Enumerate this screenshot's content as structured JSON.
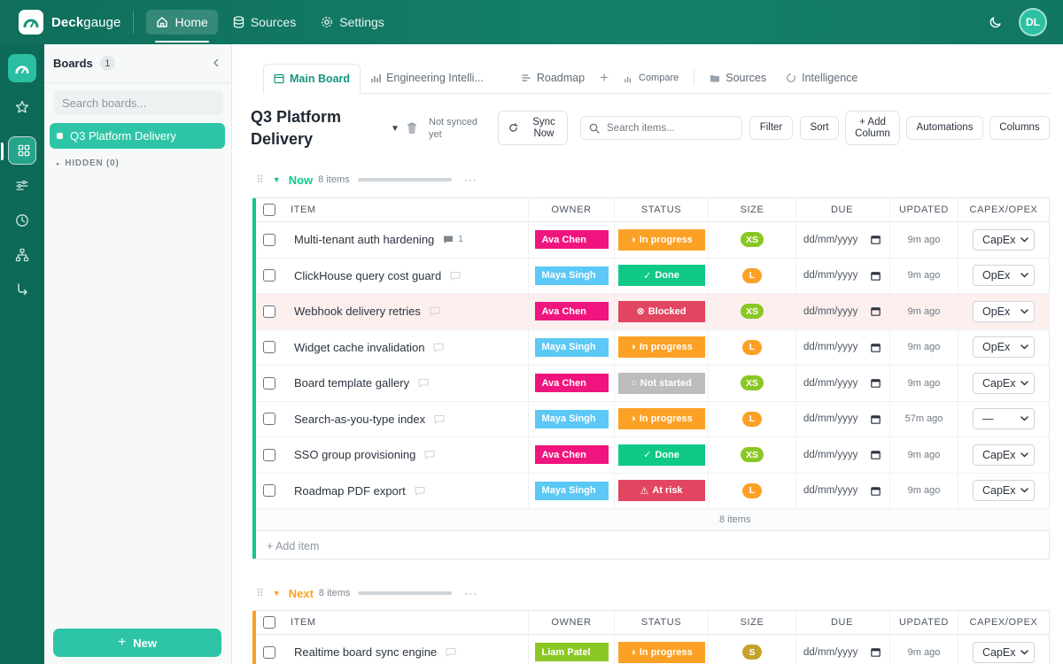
{
  "app": {
    "brand_bold": "Deck",
    "brand_light": "gauge",
    "nav": [
      {
        "label": "Home",
        "icon": "home-icon",
        "active": true
      },
      {
        "label": "Sources",
        "icon": "database-icon"
      },
      {
        "label": "Settings",
        "icon": "gear-icon"
      }
    ],
    "user_initials": "DL"
  },
  "sidebar": {
    "title": "Boards",
    "count": "1",
    "search_placeholder": "Search boards...",
    "boards": [
      {
        "label": "Q3 Platform Delivery"
      }
    ],
    "hidden_label": "HIDDEN (0)",
    "new_label": "New"
  },
  "tabs": [
    {
      "label": "Main Board",
      "icon": "table-icon",
      "active": true
    },
    {
      "label": "Engineering Intelli...",
      "icon": "bar-chart-icon"
    },
    {
      "label": "Roadmap",
      "icon": "list-icon"
    },
    {
      "label": "+",
      "icon": "plus-icon"
    },
    {
      "label": "Compare",
      "icon": "bar-chart-icon"
    },
    {
      "label": "Sources",
      "icon": "folder-icon"
    },
    {
      "label": "Intelligence",
      "icon": "circle-icon"
    }
  ],
  "toolbar": {
    "board_title": "Q3 Platform Delivery",
    "sync_status": "Not synced yet",
    "sync_now": "Sync Now",
    "search_placeholder": "Search items...",
    "filter": "Filter",
    "sort": "Sort",
    "add_column": "+ Add Column",
    "automations": "Automations",
    "columns": "Columns"
  },
  "columns": [
    "ITEM",
    "OWNER",
    "STATUS",
    "SIZE",
    "DUE",
    "UPDATED",
    "CAPEX/OPEX"
  ],
  "colors": {
    "ava": "#f0157e",
    "maya": "#5bc8f5",
    "liam": "#8bc724",
    "in_progress": "#fba126",
    "done": "#10c987",
    "blocked": "#e24560",
    "not_started": "#bdbdbd",
    "at_risk": "#e24560",
    "size_xs": "#8bc724",
    "size_l": "#fba126",
    "size_s": "#c4a22b",
    "now": "#10c987",
    "next": "#fba126"
  },
  "groups": [
    {
      "name": "Now",
      "count": "8 items",
      "summary": "8 items",
      "add_item": "+ Add item",
      "rows": [
        {
          "item": "Multi-tenant auth hardening",
          "comments": "1",
          "owner": "Ava Chen",
          "status": "In progress",
          "size": "XS",
          "due": "dd/mm/yyyy",
          "updated": "9m ago",
          "capex": "CapEx"
        },
        {
          "item": "ClickHouse query cost guard",
          "comments": "",
          "owner": "Maya Singh",
          "status": "Done",
          "size": "L",
          "due": "dd/mm/yyyy",
          "updated": "9m ago",
          "capex": "OpEx"
        },
        {
          "item": "Webhook delivery retries",
          "comments": "",
          "owner": "Ava Chen",
          "status": "Blocked",
          "size": "XS",
          "due": "dd/mm/yyyy",
          "updated": "9m ago",
          "capex": "OpEx"
        },
        {
          "item": "Widget cache invalidation",
          "comments": "",
          "owner": "Maya Singh",
          "status": "In progress",
          "size": "L",
          "due": "dd/mm/yyyy",
          "updated": "9m ago",
          "capex": "OpEx"
        },
        {
          "item": "Board template gallery",
          "comments": "",
          "owner": "Ava Chen",
          "status": "Not started",
          "size": "XS",
          "due": "dd/mm/yyyy",
          "updated": "9m ago",
          "capex": "CapEx"
        },
        {
          "item": "Search-as-you-type index",
          "comments": "",
          "owner": "Maya Singh",
          "status": "In progress",
          "size": "L",
          "due": "dd/mm/yyyy",
          "updated": "57m ago",
          "capex": "—"
        },
        {
          "item": "SSO group provisioning",
          "comments": "",
          "owner": "Ava Chen",
          "status": "Done",
          "size": "XS",
          "due": "dd/mm/yyyy",
          "updated": "9m ago",
          "capex": "CapEx"
        },
        {
          "item": "Roadmap PDF export",
          "comments": "",
          "owner": "Maya Singh",
          "status": "At risk",
          "size": "L",
          "due": "dd/mm/yyyy",
          "updated": "9m ago",
          "capex": "CapEx"
        }
      ]
    },
    {
      "name": "Next",
      "count": "8 items",
      "rows": [
        {
          "item": "Realtime board sync engine",
          "comments": "",
          "owner": "Liam Patel",
          "status": "In progress",
          "size": "S",
          "due": "dd/mm/yyyy",
          "updated": "9m ago",
          "capex": "CapEx"
        }
      ]
    }
  ]
}
